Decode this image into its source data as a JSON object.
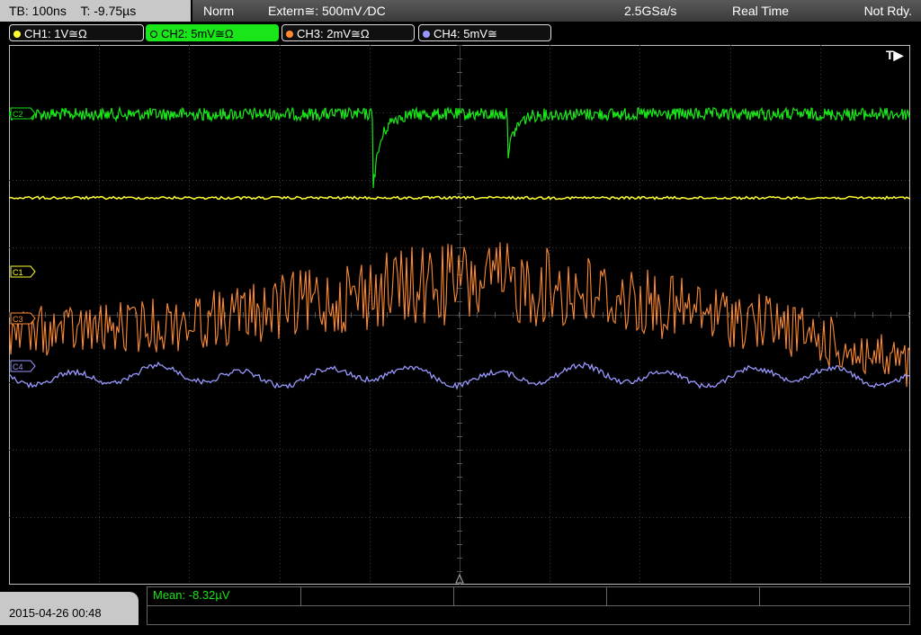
{
  "topbar": {
    "timebase": "TB: 100ns",
    "trigger_time": "T: -9.75µs",
    "mode": "Norm",
    "trigger_source": "Extern≅: 500mV ⁄DC",
    "sample_rate": "2.5GSa/s",
    "acq_mode": "Real Time",
    "status": "Not Rdy."
  },
  "channels": [
    {
      "label": "CH1: 1V≅Ω",
      "color": "#ffff30"
    },
    {
      "label": "CH2: 5mV≅Ω",
      "color": "#19e619"
    },
    {
      "label": "CH3: 2mV≅Ω",
      "color": "#ff8a30"
    },
    {
      "label": "CH4: 5mV≅",
      "color": "#9898ff"
    }
  ],
  "screen": {
    "trigger_marker": "T▶",
    "marker_labels": [
      "C2",
      "C1",
      "C3",
      "C4"
    ]
  },
  "footer": {
    "datetime": "2015-04-26 00:48",
    "measurement": "Mean: -8.32µV"
  }
}
